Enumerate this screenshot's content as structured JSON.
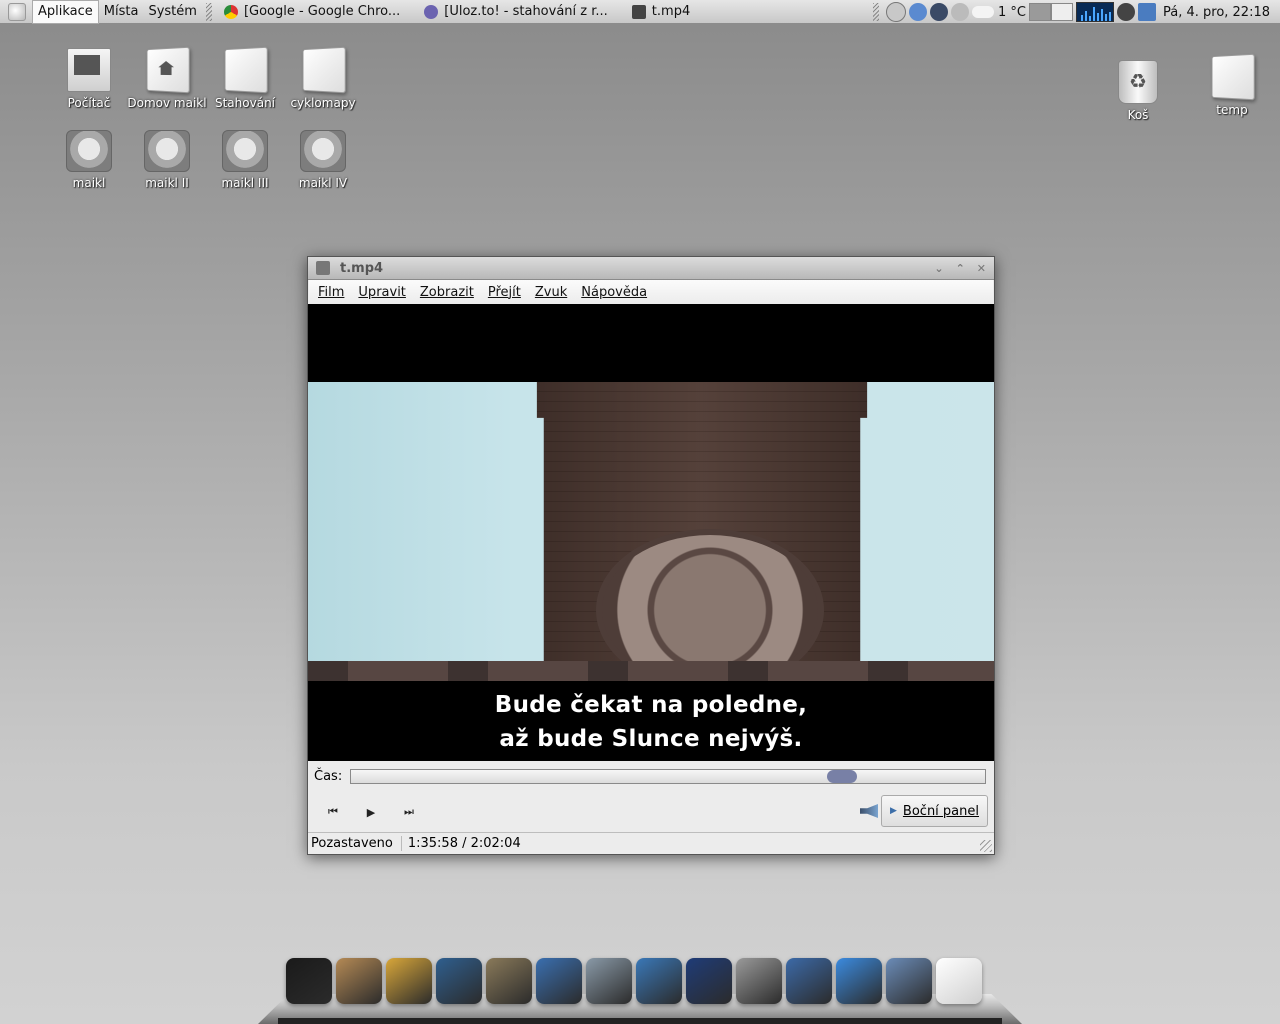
{
  "panel": {
    "menus": [
      "Aplikace",
      "Místa",
      "Systém"
    ],
    "tasks": [
      {
        "label": "[Google - Google Chro...",
        "icon": "chrome-icon",
        "color": "#2a8c3a"
      },
      {
        "label": "[Uloz.to! - stahování z r...",
        "icon": "browser-icon",
        "color": "#6b63b0"
      },
      {
        "label": "t.mp4",
        "icon": "video-icon",
        "color": "#444444"
      }
    ],
    "weather": "1 °C",
    "clock": "Pá,  4. pro, 22:18"
  },
  "desktop": {
    "icons": [
      {
        "label": "Počítač",
        "icon": "computer-icon"
      },
      {
        "label": "Domov maikl",
        "icon": "home-folder-icon"
      },
      {
        "label": "Stahování",
        "icon": "folder-icon"
      },
      {
        "label": "cyklomapy",
        "icon": "folder-icon"
      },
      {
        "label": "maikl",
        "icon": "drive-icon"
      },
      {
        "label": "maikl II",
        "icon": "drive-icon"
      },
      {
        "label": "maikl III",
        "icon": "drive-icon"
      },
      {
        "label": "maikl IV",
        "icon": "drive-icon"
      },
      {
        "label": "Koš",
        "icon": "trash-icon"
      },
      {
        "label": "temp",
        "icon": "folder-icon"
      }
    ]
  },
  "player": {
    "title": "t.mp4",
    "menu": [
      "Film",
      "Upravit",
      "Zobrazit",
      "Přejít",
      "Zvuk",
      "Nápověda"
    ],
    "subtitles": [
      "Bude čekat na poledne,",
      "až bude Slunce nejvýš."
    ],
    "time_label": "Čas:",
    "progress": 0.788,
    "sidebar_label": "Boční panel",
    "status": "Pozastaveno",
    "time": "1:35:58 / 2:02:04"
  },
  "dock": {
    "items": [
      {
        "icon": "terminal-icon",
        "color": "#1a1a1a"
      },
      {
        "icon": "package-icon",
        "color": "#b58a55"
      },
      {
        "icon": "text-editor-icon",
        "color": "#d9a73a"
      },
      {
        "icon": "system-monitor-icon",
        "color": "#2f5f8f"
      },
      {
        "icon": "gimp-icon",
        "color": "#8a7a5a"
      },
      {
        "icon": "floppy-icon",
        "color": "#3a6fb0"
      },
      {
        "icon": "satellite-icon",
        "color": "#8a9aa8"
      },
      {
        "icon": "wolf-icon",
        "color": "#3a78b8"
      },
      {
        "icon": "clapperboard-icon",
        "color": "#1f3c78"
      },
      {
        "icon": "globe-icon",
        "color": "#9a9a9a"
      },
      {
        "icon": "sphere-icon",
        "color": "#3c6aa8"
      },
      {
        "icon": "video-chat-icon",
        "color": "#3b8be0"
      },
      {
        "icon": "mail-stamp-icon",
        "color": "#6b8cb8"
      },
      {
        "icon": "folder-icon",
        "color": "#e8e8e8"
      }
    ]
  }
}
